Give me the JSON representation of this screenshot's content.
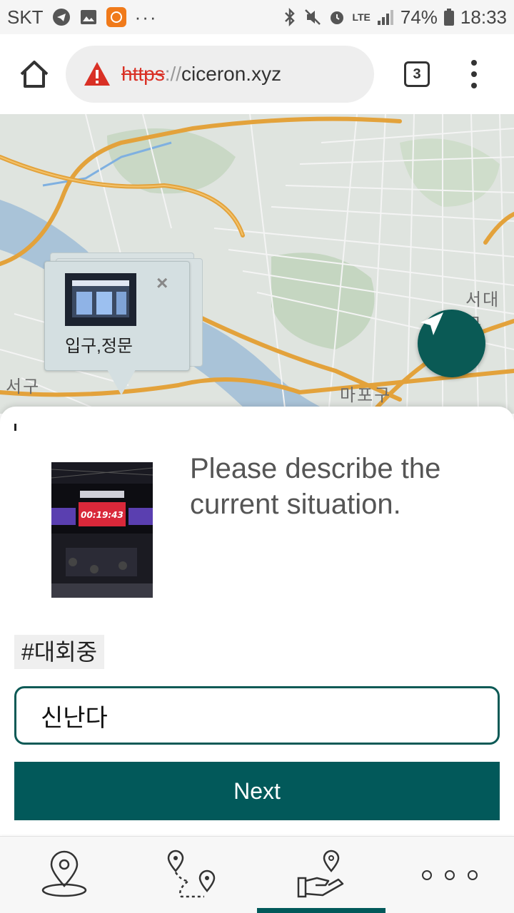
{
  "status_bar": {
    "carrier": "SKT",
    "signal_label": "LTE",
    "battery": "74%",
    "time": "18:33",
    "more": "···"
  },
  "browser": {
    "url_scheme": "https",
    "url_separator": "://",
    "url_host": "ciceron.xyz",
    "tab_count": "3"
  },
  "map": {
    "labels": [
      "서대문",
      "마포구",
      "서구"
    ],
    "popup": {
      "title": "입구,정문",
      "close": "×"
    }
  },
  "form": {
    "prompt": "Please describe the current situation.",
    "tag": "#대회중",
    "input_value": "신난다",
    "next_label": "Next"
  },
  "photo": {
    "timer": "00:19:43"
  },
  "colors": {
    "primary": "#02595a",
    "warning": "#d93025"
  }
}
